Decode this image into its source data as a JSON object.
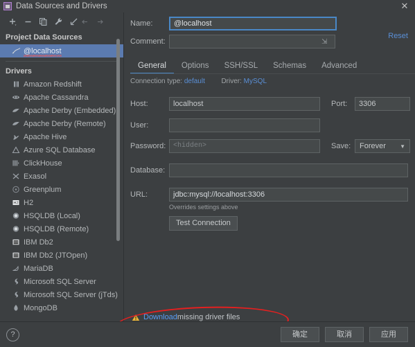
{
  "titlebar": {
    "title": "Data Sources and Drivers",
    "app_icon": "datasource-icon",
    "close_label": "✕"
  },
  "sidebar": {
    "toolbar": [
      {
        "name": "add-button",
        "glyph": "+"
      },
      {
        "name": "remove-button",
        "glyph": "−"
      },
      {
        "name": "copy-button",
        "glyph": "copy-icon"
      },
      {
        "name": "properties-button",
        "glyph": "wrench-icon"
      },
      {
        "name": "import-button",
        "glyph": "import-icon"
      },
      {
        "name": "back-button",
        "glyph": "←"
      },
      {
        "name": "forward-button",
        "glyph": "→"
      }
    ],
    "project_section_title": "Project Data Sources",
    "data_sources": [
      {
        "label": "@localhost",
        "icon": "mysql-icon",
        "selected": true,
        "error": true
      }
    ],
    "drivers_section_title": "Drivers",
    "drivers": [
      {
        "label": "Amazon Redshift",
        "icon": "redshift-icon"
      },
      {
        "label": "Apache Cassandra",
        "icon": "cassandra-icon"
      },
      {
        "label": "Apache Derby (Embedded)",
        "icon": "derby-icon"
      },
      {
        "label": "Apache Derby (Remote)",
        "icon": "derby-icon"
      },
      {
        "label": "Apache Hive",
        "icon": "hive-icon"
      },
      {
        "label": "Azure SQL Database",
        "icon": "azure-icon"
      },
      {
        "label": "ClickHouse",
        "icon": "clickhouse-icon"
      },
      {
        "label": "Exasol",
        "icon": "exasol-icon"
      },
      {
        "label": "Greenplum",
        "icon": "greenplum-icon"
      },
      {
        "label": "H2",
        "icon": "h2-icon"
      },
      {
        "label": "HSQLDB (Local)",
        "icon": "hsqldb-icon"
      },
      {
        "label": "HSQLDB (Remote)",
        "icon": "hsqldb-icon"
      },
      {
        "label": "IBM Db2",
        "icon": "db2-icon"
      },
      {
        "label": "IBM Db2 (JTOpen)",
        "icon": "db2-icon"
      },
      {
        "label": "MariaDB",
        "icon": "mariadb-icon"
      },
      {
        "label": "Microsoft SQL Server",
        "icon": "mssql-icon"
      },
      {
        "label": "Microsoft SQL Server (jTds)",
        "icon": "mssql-icon"
      },
      {
        "label": "MongoDB",
        "icon": "mongodb-icon"
      }
    ]
  },
  "form": {
    "name_label": "Name:",
    "name_value": "@localhost",
    "name_trailing_icon": "circle-icon",
    "comment_label": "Comment:",
    "comment_value": "",
    "comment_trailing_icon": "expand-icon",
    "reset_label": "Reset",
    "tabs": [
      {
        "label": "General",
        "active": true
      },
      {
        "label": "Options",
        "active": false
      },
      {
        "label": "SSH/SSL",
        "active": false
      },
      {
        "label": "Schemas",
        "active": false
      },
      {
        "label": "Advanced",
        "active": false
      }
    ],
    "connection_type_label": "Connection type:",
    "connection_type_value": "default",
    "driver_label": "Driver:",
    "driver_value": "MySQL",
    "host_label": "Host:",
    "host_value": "localhost",
    "port_label": "Port:",
    "port_value": "3306",
    "user_label": "User:",
    "user_value": "",
    "password_label": "Password:",
    "password_placeholder": "<hidden>",
    "save_label": "Save:",
    "save_value": "Forever",
    "save_caret": "▼",
    "database_label": "Database:",
    "database_value": "",
    "url_label": "URL:",
    "url_value": "jdbc:mysql://localhost:3306",
    "url_note": "Overrides settings above",
    "test_connection_label": "Test Connection"
  },
  "warning": {
    "icon": "warning-triangle-icon",
    "link_text": "Download",
    "rest_text": " missing driver files",
    "annotation": "red-oval-highlight"
  },
  "footer": {
    "help_label": "?",
    "buttons": [
      {
        "name": "ok-button",
        "label": "确定"
      },
      {
        "name": "cancel-button",
        "label": "取消"
      },
      {
        "name": "apply-button",
        "label": "应用"
      }
    ]
  },
  "colors": {
    "background": "#3c3f41",
    "field_bg": "#45494a",
    "accent_blue": "#4a88c7",
    "link_blue": "#589df6",
    "selection_blue": "#5b7bb0",
    "warning_yellow": "#e8b339",
    "annotation_red": "#e42020"
  }
}
